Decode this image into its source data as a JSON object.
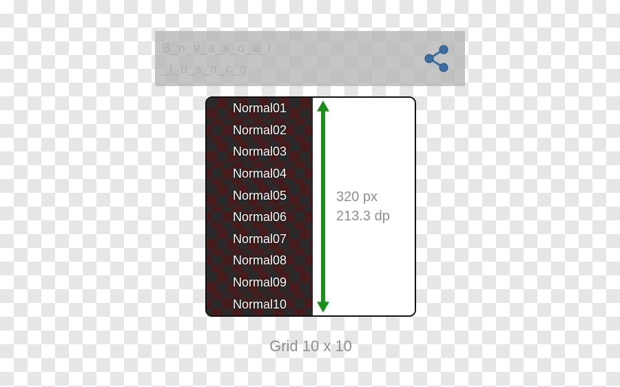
{
  "header": {
    "line1": "B_n_v_a_x_o_a_l",
    "line2": "_l_u_s_a_c_g"
  },
  "share_icon": "share",
  "list": {
    "items": [
      "Normal01",
      "Normal02",
      "Normal03",
      "Normal04",
      "Normal05",
      "Normal06",
      "Normal07",
      "Normal08",
      "Normal09",
      "Normal10"
    ]
  },
  "dimensions": {
    "px": "320 px",
    "dp": "213.3 dp"
  },
  "caption": "Grid 10 x 10",
  "colors": {
    "arrow": "#1a8f1a",
    "share_node": "#3a6ea5"
  }
}
